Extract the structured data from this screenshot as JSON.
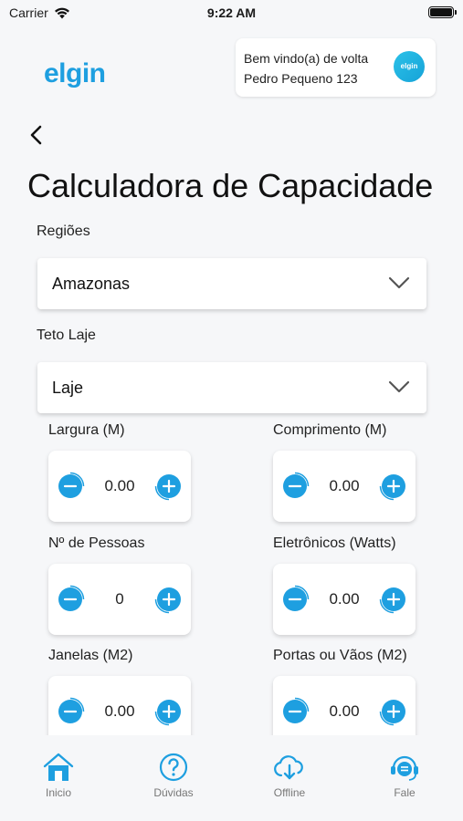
{
  "status_bar": {
    "carrier": "Carrier",
    "time": "9:22 AM"
  },
  "header": {
    "logo": "elgin",
    "welcome_line1": "Bem vindo(a) de volta",
    "welcome_line2": "Pedro Pequeno 123",
    "avatar_text": "elgin"
  },
  "page": {
    "title": "Calculadora de Capacidade"
  },
  "regioes": {
    "label": "Regiões",
    "value": "Amazonas"
  },
  "teto": {
    "label": "Teto Laje",
    "value": "Laje"
  },
  "steppers": {
    "largura": {
      "label": "Largura (M)",
      "value": "0.00"
    },
    "comprimento": {
      "label": "Comprimento (M)",
      "value": "0.00"
    },
    "pessoas": {
      "label": "Nº de Pessoas",
      "value": "0"
    },
    "eletronicos": {
      "label": "Eletrônicos (Watts)",
      "value": "0.00"
    },
    "janelas": {
      "label": "Janelas (M2)",
      "value": "0.00"
    },
    "portas": {
      "label": "Portas ou Vãos (M2)",
      "value": "0.00"
    }
  },
  "tabs": [
    {
      "label": "Inicio",
      "icon": "home-icon"
    },
    {
      "label": "Dúvidas",
      "icon": "question-icon"
    },
    {
      "label": "Offline",
      "icon": "cloud-download-icon"
    },
    {
      "label": "Fale",
      "icon": "support-chat-icon"
    }
  ],
  "colors": {
    "accent": "#1e9fe0",
    "background": "#f6f7f9",
    "card": "#ffffff"
  }
}
